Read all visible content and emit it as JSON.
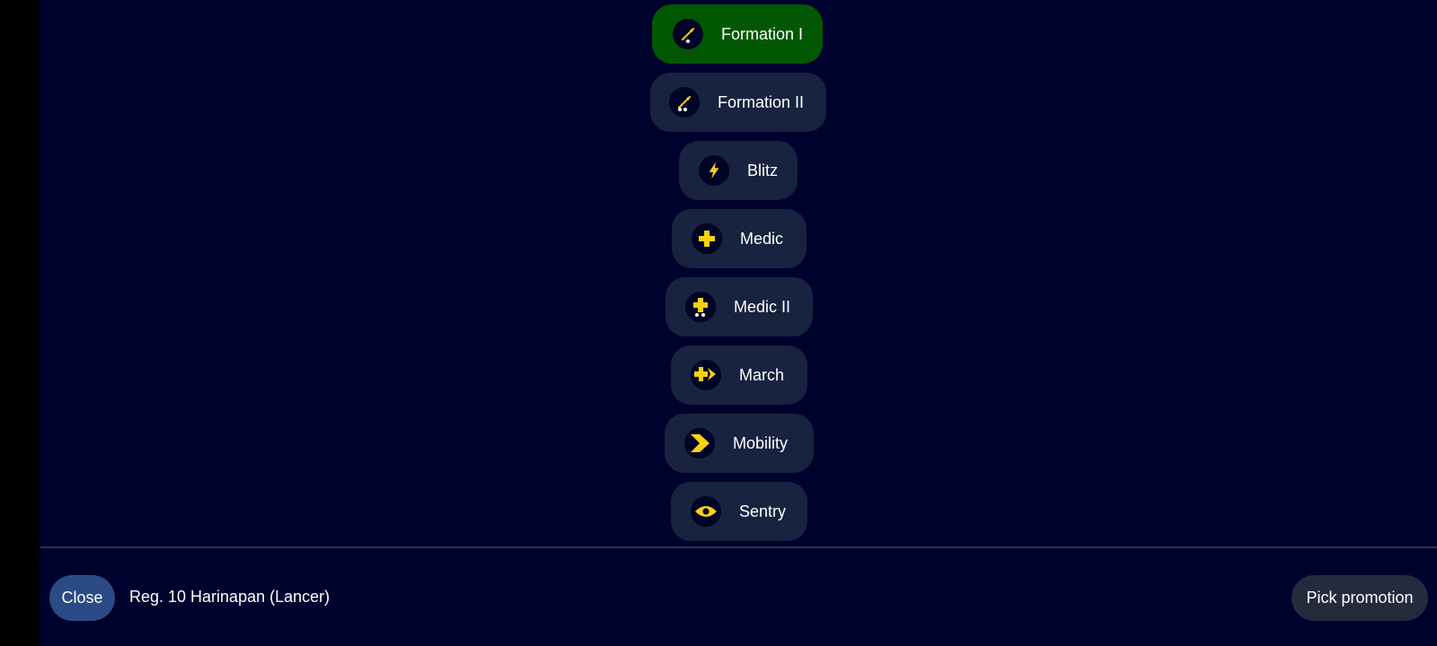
{
  "promotions": [
    {
      "label": "Formation I",
      "icon": "spear-one-star-icon",
      "selected": true
    },
    {
      "label": "Formation II",
      "icon": "spear-two-star-icon",
      "selected": false
    },
    {
      "label": "Blitz",
      "icon": "lightning-icon",
      "selected": false
    },
    {
      "label": "Medic",
      "icon": "medic-cross-icon",
      "selected": false
    },
    {
      "label": "Medic II",
      "icon": "medic-cross-two-star-icon",
      "selected": false
    },
    {
      "label": "March",
      "icon": "march-arrow-icon",
      "selected": false
    },
    {
      "label": "Mobility",
      "icon": "chevron-icon",
      "selected": false
    },
    {
      "label": "Sentry",
      "icon": "eye-icon",
      "selected": false
    }
  ],
  "footer": {
    "close_label": "Close",
    "unit_name": "Reg. 10 Harinapan (Lancer)",
    "pick_label": "Pick promotion"
  },
  "colors": {
    "background": "#00022e",
    "button": "#17233f",
    "selected": "#025802",
    "icon_accent": "#f7d20f",
    "close_button": "#2c4a86",
    "pick_button": "#242b3d"
  }
}
